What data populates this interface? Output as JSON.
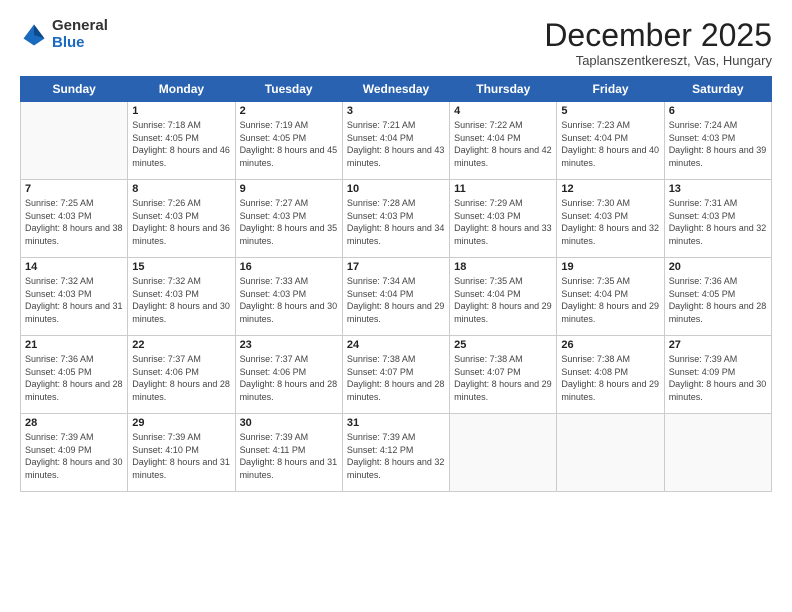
{
  "logo": {
    "general": "General",
    "blue": "Blue"
  },
  "title": {
    "month": "December 2025",
    "location": "Taplanszentkereszt, Vas, Hungary"
  },
  "weekdays": [
    "Sunday",
    "Monday",
    "Tuesday",
    "Wednesday",
    "Thursday",
    "Friday",
    "Saturday"
  ],
  "weeks": [
    [
      {
        "day": "",
        "sunrise": "",
        "sunset": "",
        "daylight": ""
      },
      {
        "day": "1",
        "sunrise": "Sunrise: 7:18 AM",
        "sunset": "Sunset: 4:05 PM",
        "daylight": "Daylight: 8 hours and 46 minutes."
      },
      {
        "day": "2",
        "sunrise": "Sunrise: 7:19 AM",
        "sunset": "Sunset: 4:05 PM",
        "daylight": "Daylight: 8 hours and 45 minutes."
      },
      {
        "day": "3",
        "sunrise": "Sunrise: 7:21 AM",
        "sunset": "Sunset: 4:04 PM",
        "daylight": "Daylight: 8 hours and 43 minutes."
      },
      {
        "day": "4",
        "sunrise": "Sunrise: 7:22 AM",
        "sunset": "Sunset: 4:04 PM",
        "daylight": "Daylight: 8 hours and 42 minutes."
      },
      {
        "day": "5",
        "sunrise": "Sunrise: 7:23 AM",
        "sunset": "Sunset: 4:04 PM",
        "daylight": "Daylight: 8 hours and 40 minutes."
      },
      {
        "day": "6",
        "sunrise": "Sunrise: 7:24 AM",
        "sunset": "Sunset: 4:03 PM",
        "daylight": "Daylight: 8 hours and 39 minutes."
      }
    ],
    [
      {
        "day": "7",
        "sunrise": "Sunrise: 7:25 AM",
        "sunset": "Sunset: 4:03 PM",
        "daylight": "Daylight: 8 hours and 38 minutes."
      },
      {
        "day": "8",
        "sunrise": "Sunrise: 7:26 AM",
        "sunset": "Sunset: 4:03 PM",
        "daylight": "Daylight: 8 hours and 36 minutes."
      },
      {
        "day": "9",
        "sunrise": "Sunrise: 7:27 AM",
        "sunset": "Sunset: 4:03 PM",
        "daylight": "Daylight: 8 hours and 35 minutes."
      },
      {
        "day": "10",
        "sunrise": "Sunrise: 7:28 AM",
        "sunset": "Sunset: 4:03 PM",
        "daylight": "Daylight: 8 hours and 34 minutes."
      },
      {
        "day": "11",
        "sunrise": "Sunrise: 7:29 AM",
        "sunset": "Sunset: 4:03 PM",
        "daylight": "Daylight: 8 hours and 33 minutes."
      },
      {
        "day": "12",
        "sunrise": "Sunrise: 7:30 AM",
        "sunset": "Sunset: 4:03 PM",
        "daylight": "Daylight: 8 hours and 32 minutes."
      },
      {
        "day": "13",
        "sunrise": "Sunrise: 7:31 AM",
        "sunset": "Sunset: 4:03 PM",
        "daylight": "Daylight: 8 hours and 32 minutes."
      }
    ],
    [
      {
        "day": "14",
        "sunrise": "Sunrise: 7:32 AM",
        "sunset": "Sunset: 4:03 PM",
        "daylight": "Daylight: 8 hours and 31 minutes."
      },
      {
        "day": "15",
        "sunrise": "Sunrise: 7:32 AM",
        "sunset": "Sunset: 4:03 PM",
        "daylight": "Daylight: 8 hours and 30 minutes."
      },
      {
        "day": "16",
        "sunrise": "Sunrise: 7:33 AM",
        "sunset": "Sunset: 4:03 PM",
        "daylight": "Daylight: 8 hours and 30 minutes."
      },
      {
        "day": "17",
        "sunrise": "Sunrise: 7:34 AM",
        "sunset": "Sunset: 4:04 PM",
        "daylight": "Daylight: 8 hours and 29 minutes."
      },
      {
        "day": "18",
        "sunrise": "Sunrise: 7:35 AM",
        "sunset": "Sunset: 4:04 PM",
        "daylight": "Daylight: 8 hours and 29 minutes."
      },
      {
        "day": "19",
        "sunrise": "Sunrise: 7:35 AM",
        "sunset": "Sunset: 4:04 PM",
        "daylight": "Daylight: 8 hours and 29 minutes."
      },
      {
        "day": "20",
        "sunrise": "Sunrise: 7:36 AM",
        "sunset": "Sunset: 4:05 PM",
        "daylight": "Daylight: 8 hours and 28 minutes."
      }
    ],
    [
      {
        "day": "21",
        "sunrise": "Sunrise: 7:36 AM",
        "sunset": "Sunset: 4:05 PM",
        "daylight": "Daylight: 8 hours and 28 minutes."
      },
      {
        "day": "22",
        "sunrise": "Sunrise: 7:37 AM",
        "sunset": "Sunset: 4:06 PM",
        "daylight": "Daylight: 8 hours and 28 minutes."
      },
      {
        "day": "23",
        "sunrise": "Sunrise: 7:37 AM",
        "sunset": "Sunset: 4:06 PM",
        "daylight": "Daylight: 8 hours and 28 minutes."
      },
      {
        "day": "24",
        "sunrise": "Sunrise: 7:38 AM",
        "sunset": "Sunset: 4:07 PM",
        "daylight": "Daylight: 8 hours and 28 minutes."
      },
      {
        "day": "25",
        "sunrise": "Sunrise: 7:38 AM",
        "sunset": "Sunset: 4:07 PM",
        "daylight": "Daylight: 8 hours and 29 minutes."
      },
      {
        "day": "26",
        "sunrise": "Sunrise: 7:38 AM",
        "sunset": "Sunset: 4:08 PM",
        "daylight": "Daylight: 8 hours and 29 minutes."
      },
      {
        "day": "27",
        "sunrise": "Sunrise: 7:39 AM",
        "sunset": "Sunset: 4:09 PM",
        "daylight": "Daylight: 8 hours and 30 minutes."
      }
    ],
    [
      {
        "day": "28",
        "sunrise": "Sunrise: 7:39 AM",
        "sunset": "Sunset: 4:09 PM",
        "daylight": "Daylight: 8 hours and 30 minutes."
      },
      {
        "day": "29",
        "sunrise": "Sunrise: 7:39 AM",
        "sunset": "Sunset: 4:10 PM",
        "daylight": "Daylight: 8 hours and 31 minutes."
      },
      {
        "day": "30",
        "sunrise": "Sunrise: 7:39 AM",
        "sunset": "Sunset: 4:11 PM",
        "daylight": "Daylight: 8 hours and 31 minutes."
      },
      {
        "day": "31",
        "sunrise": "Sunrise: 7:39 AM",
        "sunset": "Sunset: 4:12 PM",
        "daylight": "Daylight: 8 hours and 32 minutes."
      },
      {
        "day": "",
        "sunrise": "",
        "sunset": "",
        "daylight": ""
      },
      {
        "day": "",
        "sunrise": "",
        "sunset": "",
        "daylight": ""
      },
      {
        "day": "",
        "sunrise": "",
        "sunset": "",
        "daylight": ""
      }
    ]
  ]
}
